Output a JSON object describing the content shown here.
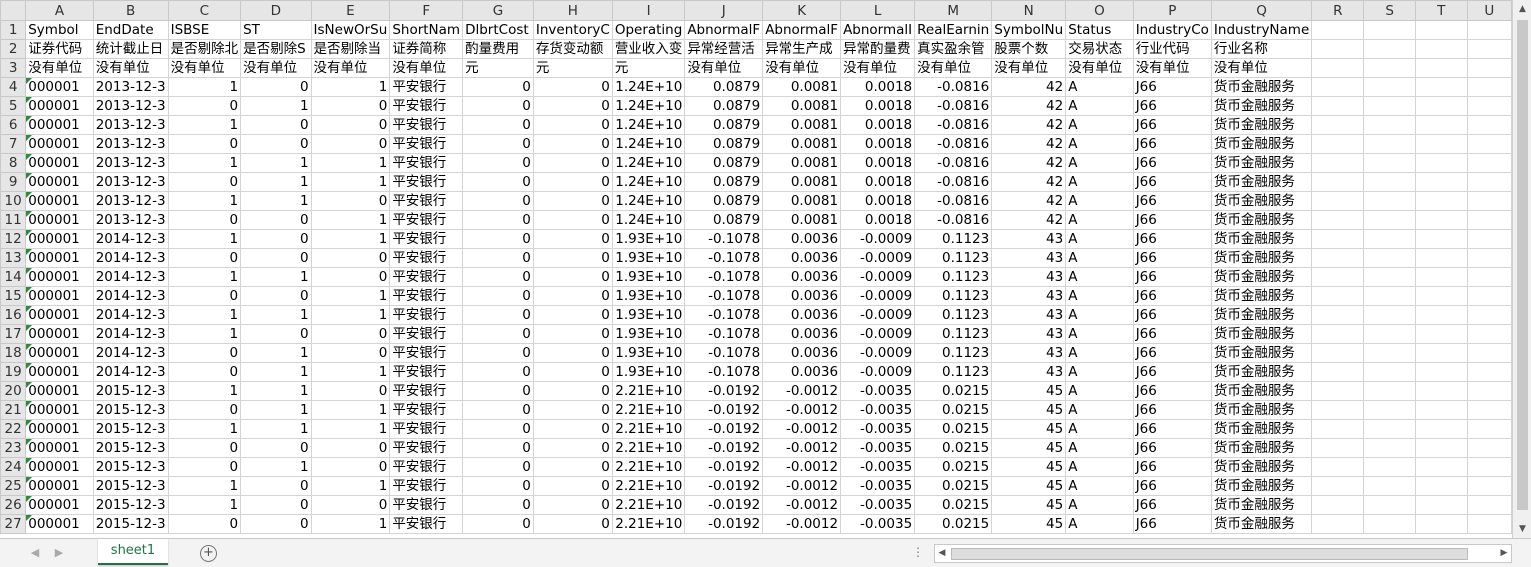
{
  "columns": [
    "A",
    "B",
    "C",
    "D",
    "E",
    "F",
    "G",
    "H",
    "I",
    "J",
    "K",
    "L",
    "M",
    "N",
    "O",
    "P",
    "Q",
    "R",
    "S",
    "T",
    "U"
  ],
  "header_row1": [
    "Symbol",
    "EndDate",
    "ISBSE",
    "ST",
    "IsNewOrSu",
    "ShortNam",
    "DlbrtCost",
    "InventoryC",
    "Operating",
    "AbnormalF",
    "AbnormalF",
    "AbnormalI",
    "RealEarnin",
    "SymbolNu",
    "Status",
    "IndustryCo",
    "IndustryName",
    "",
    "",
    "",
    ""
  ],
  "header_row2": [
    "证券代码",
    "统计截止日",
    "是否剔除北",
    "是否剔除S",
    "是否剔除当",
    "证券简称",
    "酌量费用",
    "存货变动额",
    "营业收入变",
    "异常经营活",
    "异常生产成",
    "异常酌量费",
    "真实盈余管",
    "股票个数",
    "交易状态",
    "行业代码",
    "行业名称",
    "",
    "",
    "",
    ""
  ],
  "header_row3": [
    "没有单位",
    "没有单位",
    "没有单位",
    "没有单位",
    "没有单位",
    "没有单位",
    "元",
    "元",
    "元",
    "没有单位",
    "没有单位",
    "没有单位",
    "没有单位",
    "没有单位",
    "没有单位",
    "没有单位",
    "没有单位",
    "",
    "",
    "",
    ""
  ],
  "data_rows": [
    [
      "000001",
      "2013-12-3",
      "1",
      "0",
      "1",
      "平安银行",
      "0",
      "0",
      "1.24E+10",
      "0.0879",
      "0.0081",
      "0.0018",
      "-0.0816",
      "42",
      "A",
      "J66",
      "货币金融服务"
    ],
    [
      "000001",
      "2013-12-3",
      "0",
      "1",
      "0",
      "平安银行",
      "0",
      "0",
      "1.24E+10",
      "0.0879",
      "0.0081",
      "0.0018",
      "-0.0816",
      "42",
      "A",
      "J66",
      "货币金融服务"
    ],
    [
      "000001",
      "2013-12-3",
      "1",
      "0",
      "0",
      "平安银行",
      "0",
      "0",
      "1.24E+10",
      "0.0879",
      "0.0081",
      "0.0018",
      "-0.0816",
      "42",
      "A",
      "J66",
      "货币金融服务"
    ],
    [
      "000001",
      "2013-12-3",
      "0",
      "0",
      "0",
      "平安银行",
      "0",
      "0",
      "1.24E+10",
      "0.0879",
      "0.0081",
      "0.0018",
      "-0.0816",
      "42",
      "A",
      "J66",
      "货币金融服务"
    ],
    [
      "000001",
      "2013-12-3",
      "1",
      "1",
      "1",
      "平安银行",
      "0",
      "0",
      "1.24E+10",
      "0.0879",
      "0.0081",
      "0.0018",
      "-0.0816",
      "42",
      "A",
      "J66",
      "货币金融服务"
    ],
    [
      "000001",
      "2013-12-3",
      "0",
      "1",
      "1",
      "平安银行",
      "0",
      "0",
      "1.24E+10",
      "0.0879",
      "0.0081",
      "0.0018",
      "-0.0816",
      "42",
      "A",
      "J66",
      "货币金融服务"
    ],
    [
      "000001",
      "2013-12-3",
      "1",
      "1",
      "0",
      "平安银行",
      "0",
      "0",
      "1.24E+10",
      "0.0879",
      "0.0081",
      "0.0018",
      "-0.0816",
      "42",
      "A",
      "J66",
      "货币金融服务"
    ],
    [
      "000001",
      "2013-12-3",
      "0",
      "0",
      "1",
      "平安银行",
      "0",
      "0",
      "1.24E+10",
      "0.0879",
      "0.0081",
      "0.0018",
      "-0.0816",
      "42",
      "A",
      "J66",
      "货币金融服务"
    ],
    [
      "000001",
      "2014-12-3",
      "1",
      "0",
      "1",
      "平安银行",
      "0",
      "0",
      "1.93E+10",
      "-0.1078",
      "0.0036",
      "-0.0009",
      "0.1123",
      "43",
      "A",
      "J66",
      "货币金融服务"
    ],
    [
      "000001",
      "2014-12-3",
      "0",
      "0",
      "0",
      "平安银行",
      "0",
      "0",
      "1.93E+10",
      "-0.1078",
      "0.0036",
      "-0.0009",
      "0.1123",
      "43",
      "A",
      "J66",
      "货币金融服务"
    ],
    [
      "000001",
      "2014-12-3",
      "1",
      "1",
      "0",
      "平安银行",
      "0",
      "0",
      "1.93E+10",
      "-0.1078",
      "0.0036",
      "-0.0009",
      "0.1123",
      "43",
      "A",
      "J66",
      "货币金融服务"
    ],
    [
      "000001",
      "2014-12-3",
      "0",
      "0",
      "1",
      "平安银行",
      "0",
      "0",
      "1.93E+10",
      "-0.1078",
      "0.0036",
      "-0.0009",
      "0.1123",
      "43",
      "A",
      "J66",
      "货币金融服务"
    ],
    [
      "000001",
      "2014-12-3",
      "1",
      "1",
      "1",
      "平安银行",
      "0",
      "0",
      "1.93E+10",
      "-0.1078",
      "0.0036",
      "-0.0009",
      "0.1123",
      "43",
      "A",
      "J66",
      "货币金融服务"
    ],
    [
      "000001",
      "2014-12-3",
      "1",
      "0",
      "0",
      "平安银行",
      "0",
      "0",
      "1.93E+10",
      "-0.1078",
      "0.0036",
      "-0.0009",
      "0.1123",
      "43",
      "A",
      "J66",
      "货币金融服务"
    ],
    [
      "000001",
      "2014-12-3",
      "0",
      "1",
      "0",
      "平安银行",
      "0",
      "0",
      "1.93E+10",
      "-0.1078",
      "0.0036",
      "-0.0009",
      "0.1123",
      "43",
      "A",
      "J66",
      "货币金融服务"
    ],
    [
      "000001",
      "2014-12-3",
      "0",
      "1",
      "1",
      "平安银行",
      "0",
      "0",
      "1.93E+10",
      "-0.1078",
      "0.0036",
      "-0.0009",
      "0.1123",
      "43",
      "A",
      "J66",
      "货币金融服务"
    ],
    [
      "000001",
      "2015-12-3",
      "1",
      "1",
      "0",
      "平安银行",
      "0",
      "0",
      "2.21E+10",
      "-0.0192",
      "-0.0012",
      "-0.0035",
      "0.0215",
      "45",
      "A",
      "J66",
      "货币金融服务"
    ],
    [
      "000001",
      "2015-12-3",
      "0",
      "1",
      "1",
      "平安银行",
      "0",
      "0",
      "2.21E+10",
      "-0.0192",
      "-0.0012",
      "-0.0035",
      "0.0215",
      "45",
      "A",
      "J66",
      "货币金融服务"
    ],
    [
      "000001",
      "2015-12-3",
      "1",
      "1",
      "1",
      "平安银行",
      "0",
      "0",
      "2.21E+10",
      "-0.0192",
      "-0.0012",
      "-0.0035",
      "0.0215",
      "45",
      "A",
      "J66",
      "货币金融服务"
    ],
    [
      "000001",
      "2015-12-3",
      "0",
      "0",
      "0",
      "平安银行",
      "0",
      "0",
      "2.21E+10",
      "-0.0192",
      "-0.0012",
      "-0.0035",
      "0.0215",
      "45",
      "A",
      "J66",
      "货币金融服务"
    ],
    [
      "000001",
      "2015-12-3",
      "0",
      "1",
      "0",
      "平安银行",
      "0",
      "0",
      "2.21E+10",
      "-0.0192",
      "-0.0012",
      "-0.0035",
      "0.0215",
      "45",
      "A",
      "J66",
      "货币金融服务"
    ],
    [
      "000001",
      "2015-12-3",
      "1",
      "0",
      "1",
      "平安银行",
      "0",
      "0",
      "2.21E+10",
      "-0.0192",
      "-0.0012",
      "-0.0035",
      "0.0215",
      "45",
      "A",
      "J66",
      "货币金融服务"
    ],
    [
      "000001",
      "2015-12-3",
      "1",
      "0",
      "0",
      "平安银行",
      "0",
      "0",
      "2.21E+10",
      "-0.0192",
      "-0.0012",
      "-0.0035",
      "0.0215",
      "45",
      "A",
      "J66",
      "货币金融服务"
    ],
    [
      "000001",
      "2015-12-3",
      "0",
      "0",
      "1",
      "平安银行",
      "0",
      "0",
      "2.21E+10",
      "-0.0192",
      "-0.0012",
      "-0.0035",
      "0.0215",
      "45",
      "A",
      "J66",
      "货币金融服务"
    ]
  ],
  "sheet_tab": "sheet1",
  "add_sheet_icon": "plus-circle-icon",
  "colors": {
    "tab_accent": "#217346",
    "error_triangle": "#2e8b3a",
    "header_bg": "#e6e6e6"
  }
}
